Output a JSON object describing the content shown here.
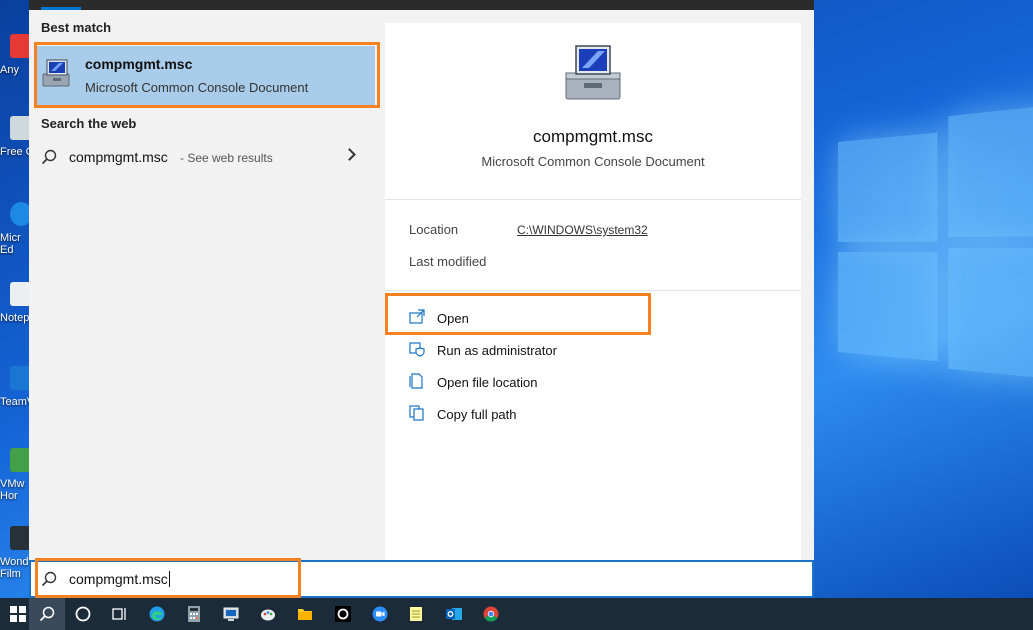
{
  "start_menu": {
    "best_match_title": "Best match",
    "best_match": {
      "name": "compmgmt.msc",
      "description": "Microsoft Common Console Document"
    },
    "search_web_title": "Search the web",
    "web_result": {
      "query": "compmgmt.msc",
      "hint": "- See web results"
    }
  },
  "detail": {
    "name": "compmgmt.msc",
    "description": "Microsoft Common Console Document",
    "location_label": "Location",
    "location_value": "C:\\WINDOWS\\system32",
    "last_modified_label": "Last modified",
    "actions": [
      {
        "label": "Open",
        "icon": "open-icon"
      },
      {
        "label": "Run as administrator",
        "icon": "shield-icon"
      },
      {
        "label": "Open file location",
        "icon": "file-location-icon"
      },
      {
        "label": "Copy full path",
        "icon": "copy-icon"
      }
    ]
  },
  "search": {
    "value": "compmgmt.msc"
  },
  "desktop_icons": [
    {
      "label": "Any",
      "color": "#e53935"
    },
    {
      "label": "Free C",
      "color": "#cfd8dc"
    },
    {
      "label": "Micr Ed",
      "color": "#1e88e5"
    },
    {
      "label": "Notep",
      "color": "#eceff1"
    },
    {
      "label": "TeamV",
      "color": "#1976d2"
    },
    {
      "label": "VMw Hor",
      "color": "#43a047"
    },
    {
      "label": "Wond Film",
      "color": "#263238"
    }
  ],
  "taskbar": {
    "items": [
      "windows-start",
      "search",
      "cortana",
      "task-view",
      "edge",
      "calculator",
      "remote-desktop",
      "paint",
      "file-explorer",
      "obs",
      "zoom",
      "notepad",
      "outlook",
      "chrome"
    ]
  },
  "colors": {
    "highlight": "#f58220",
    "selection": "#a8cce9",
    "accent": "#0078d4"
  }
}
